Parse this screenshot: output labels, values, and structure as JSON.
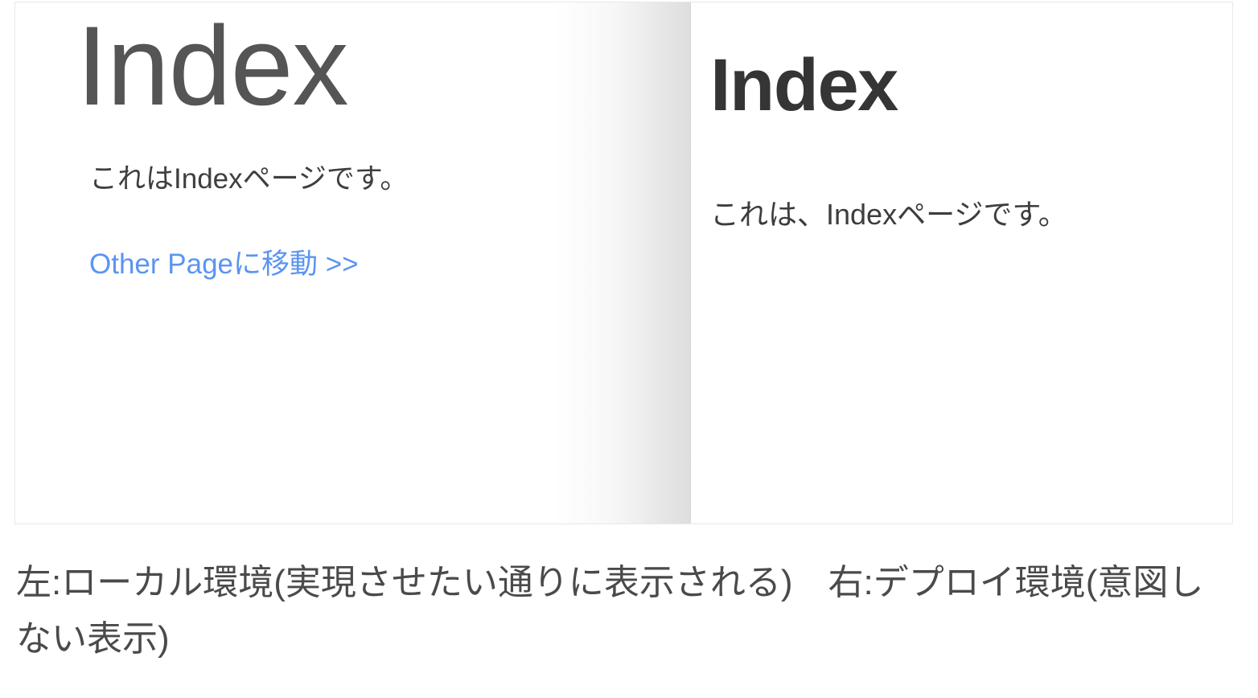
{
  "figure": {
    "panels": [
      {
        "id": "local",
        "environment_label": "local",
        "heading": "Index",
        "paragraph": "これはIndexページです。",
        "link_label": "Other Pageに移動 >>",
        "link_color": "#5b94f2",
        "heading_color": "#555555",
        "text_color": "#3f3f3f"
      },
      {
        "id": "deploy",
        "environment_label": "deploy",
        "heading": "Index",
        "paragraph": "これは、Indexページです。",
        "heading_color": "#353535",
        "text_color": "#3d3d3d"
      }
    ],
    "border_color": "#e8e8e8",
    "divider_color": "#d6d6d6"
  },
  "caption": {
    "text": "左:ローカル環境(実現させたい通りに表示される)　右:デプロイ環境(意図しない表示)",
    "color": "#4a4a4a"
  }
}
